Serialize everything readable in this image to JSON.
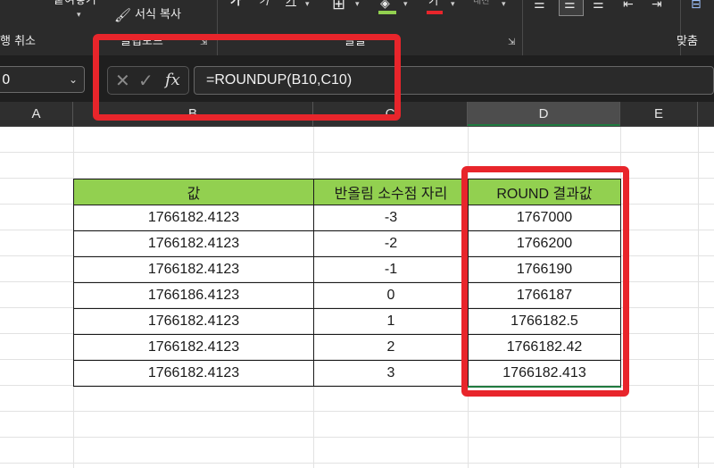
{
  "ribbon": {
    "paste_label": "붙여넣기",
    "format_painter_label": "서식 복사",
    "undo_label": "행 취소",
    "clipboard_label": "클립보드",
    "font_label": "글꼴",
    "alignment_label": "맞춤",
    "bold_glyph": "가",
    "italic_glyph": "가",
    "underline_glyph": "가",
    "font_color_glyph": "가"
  },
  "formula_bar": {
    "name_box": "0",
    "formula": "=ROUNDUP(B10,C10)",
    "cancel_glyph": "✕",
    "enter_glyph": "✓",
    "fx_glyph": "fx"
  },
  "columns": [
    "A",
    "B",
    "C",
    "D",
    "E"
  ],
  "table": {
    "headers": [
      "값",
      "반올림 소수점 자리",
      "ROUND 결과값"
    ],
    "rows": [
      [
        "1766182.4123",
        "-3",
        "1767000"
      ],
      [
        "1766182.4123",
        "-2",
        "1766200"
      ],
      [
        "1766182.4123",
        "-1",
        "1766190"
      ],
      [
        "1766186.4123",
        "0",
        "1766187"
      ],
      [
        "1766182.4123",
        "1",
        "1766182.5"
      ],
      [
        "1766182.4123",
        "2",
        "1766182.42"
      ],
      [
        "1766182.4123",
        "3",
        "1766182.413"
      ]
    ]
  },
  "colors": {
    "header_fill": "#92d050",
    "highlight": "#e8252b",
    "ribbon_bg": "#2b2b2b"
  }
}
